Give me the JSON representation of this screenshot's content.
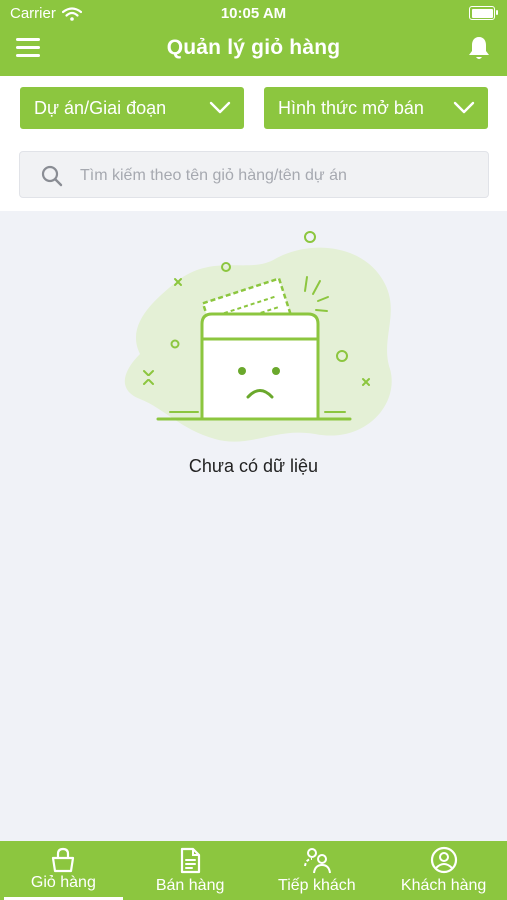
{
  "status_bar": {
    "carrier": "Carrier",
    "time": "10:05 AM"
  },
  "header": {
    "title": "Quản lý giỏ hàng",
    "menu_icon": "menu-icon",
    "bell_icon": "bell-icon"
  },
  "filters": {
    "project_dropdown": "Dự án/Giai đoạn",
    "sale_type_dropdown": "Hình thức mở bán"
  },
  "search": {
    "placeholder": "Tìm kiếm theo tên giỏ hàng/tên dự án",
    "value": ""
  },
  "empty_state": {
    "message": "Chưa có dữ liệu",
    "icon": "empty-folder-illustration"
  },
  "tabs": [
    {
      "label": "Giỏ hàng",
      "icon": "shopping-bag-icon",
      "active": true
    },
    {
      "label": "Bán hàng",
      "icon": "document-icon",
      "active": false
    },
    {
      "label": "Tiếp khách",
      "icon": "people-icon",
      "active": false
    },
    {
      "label": "Khách hàng",
      "icon": "user-circle-icon",
      "active": false
    }
  ],
  "colors": {
    "brand": "#8cc63f",
    "background": "#f0f2f7",
    "blob": "#e4f0d6"
  }
}
